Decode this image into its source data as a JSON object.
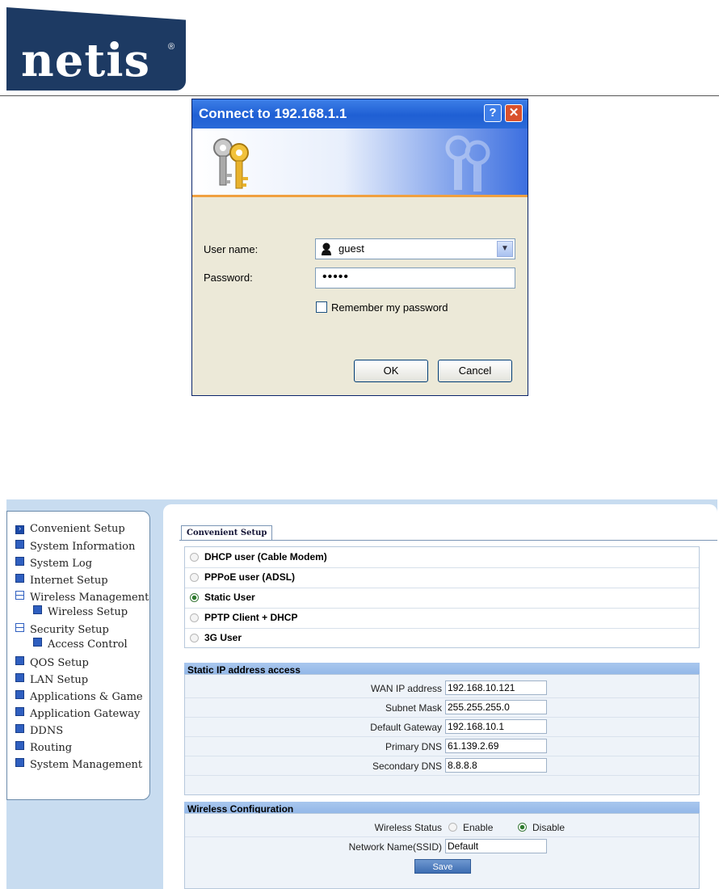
{
  "logo": {
    "text": "netis",
    "reg": "®"
  },
  "login_dialog": {
    "title": "Connect to 192.168.1.1",
    "help_label": "?",
    "close_label": "✕",
    "username_label": "User name:",
    "username_value": "guest",
    "password_label": "Password:",
    "password_value": "•••••",
    "remember_label": "Remember my password",
    "ok_label": "OK",
    "cancel_label": "Cancel"
  },
  "router": {
    "nav": [
      "Convenient Setup",
      "System Information",
      "System Log",
      "Internet Setup",
      "Wireless Management",
      "Wireless Setup",
      "Security Setup",
      "Access Control",
      "QOS Setup",
      "LAN Setup",
      "Applications & Game",
      "Application Gateway",
      "DDNS",
      "Routing",
      "System Management"
    ],
    "tab_label": "Convenient Setup",
    "connection_options": [
      "DHCP user (Cable Modem)",
      "PPPoE user (ADSL)",
      "Static User",
      "PPTP Client + DHCP",
      "3G User"
    ],
    "selected_option": "Static User",
    "static_section_title": "Static IP address access",
    "static_fields": [
      {
        "label": "WAN IP address",
        "value": "192.168.10.121"
      },
      {
        "label": "Subnet Mask",
        "value": "255.255.255.0"
      },
      {
        "label": "Default Gateway",
        "value": "192.168.10.1"
      },
      {
        "label": "Primary DNS",
        "value": "61.139.2.69"
      },
      {
        "label": "Secondary DNS",
        "value": "8.8.8.8"
      }
    ],
    "wireless_section_title": "Wireless Configuration",
    "wireless_status_label": "Wireless Status",
    "enable_label": "Enable",
    "disable_label": "Disable",
    "wireless_status_selected": "Disable",
    "ssid_label": "Network Name(SSID)",
    "ssid_value": "Default",
    "save_label": "Save"
  }
}
